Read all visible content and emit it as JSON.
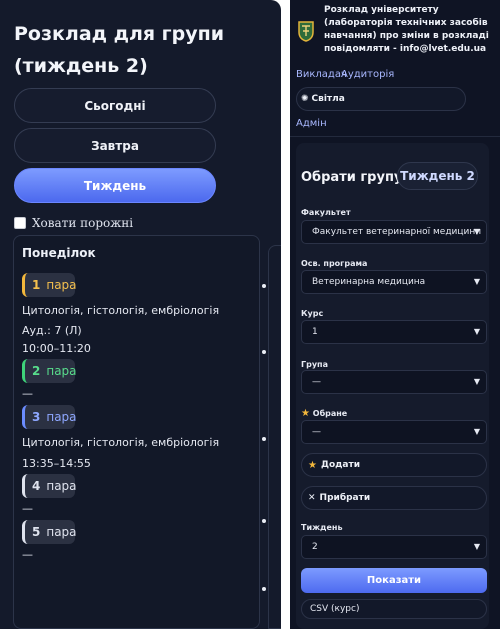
{
  "left": {
    "title": "Розклад для групи (тиждень 2)",
    "buttons": {
      "today": "Сьогодні",
      "tomorrow": "Завтра",
      "week": "Тиждень"
    },
    "hide_empty_label": "Ховати порожні",
    "day": {
      "name": "Понеділок",
      "lessons": [
        {
          "num": "1",
          "label": "пара",
          "subject": "Цитологія, гістологія, ембріологія",
          "room": "Ауд.: 7 (Л)",
          "time": "10:00–11:20"
        },
        {
          "num": "2",
          "label": "пара",
          "empty": "—"
        },
        {
          "num": "3",
          "label": "пара",
          "subject": "Цитологія, гістологія, ембріологія",
          "time": "13:35–14:55"
        },
        {
          "num": "4",
          "label": "пара",
          "empty": "—"
        },
        {
          "num": "5",
          "label": "пара",
          "empty": "—"
        }
      ]
    }
  },
  "right": {
    "header": "Розклад університету (лабораторія технічних засобів навчання) про зміни в розкладі повідомляти - info@lvet.edu.ua",
    "nav": {
      "teacher": "Викладач",
      "room": "Аудиторія",
      "theme": "Світла",
      "admin": "Адмін"
    },
    "panel": {
      "title": "Обрати групу",
      "week_badge": "Тиждень 2",
      "faculty_label": "Факультет",
      "faculty_value": "Факультет ветеринарної медицини",
      "program_label": "Осв. програма",
      "program_value": "Ветеринарна медицина",
      "course_label": "Курс",
      "course_value": "1",
      "group_label": "Група",
      "group_value": "—",
      "favorites_label": "Обране",
      "favorites_value": "—",
      "add_label": "Додати",
      "remove_label": "Прибрати",
      "week_label": "Тиждень",
      "week_value": "2",
      "show_label": "Показати",
      "csv_label": "CSV (курс)"
    }
  },
  "colors": {
    "accent": "#5b78f5",
    "lesson1": "#f2b73c",
    "lesson2": "#3ed47a",
    "lesson3": "#6b8cff"
  },
  "icons": {
    "theme": "sun-icon",
    "add": "star-icon",
    "remove": "cross-icon",
    "select": "chevron-down-icon",
    "logo": "university-crest-icon"
  }
}
